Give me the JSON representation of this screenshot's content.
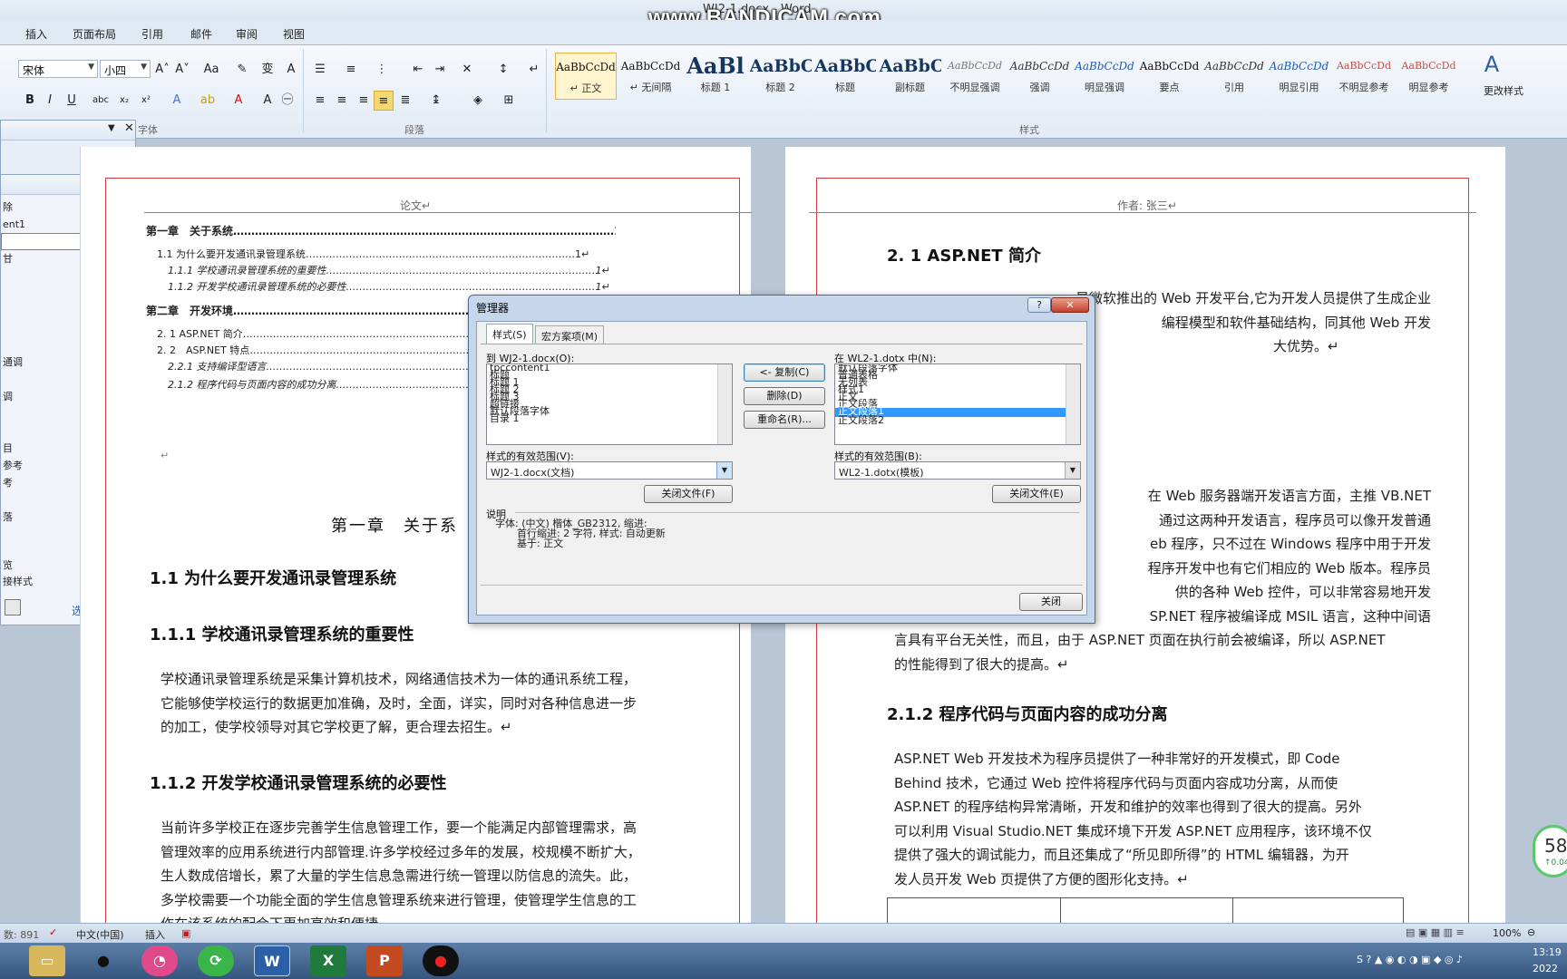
{
  "app": {
    "title": "WJ2-1.docx - Word",
    "watermark": "www.BANDICAM.com"
  },
  "ribbon": {
    "tabs": [
      "插入",
      "页面布局",
      "引用",
      "邮件",
      "审阅",
      "视图"
    ],
    "font_name": "宋体",
    "font_size": "小四",
    "group_labels": {
      "font": "字体",
      "paragraph": "段落",
      "styles": "样式"
    },
    "change_styles": "更改样式",
    "styles": [
      {
        "sample": "AaBbCcDd",
        "name": "↵ 正文"
      },
      {
        "sample": "AaBbCcDd",
        "name": "↵ 无间隔"
      },
      {
        "sample": "AaBl",
        "name": "标题 1"
      },
      {
        "sample": "AaBbC",
        "name": "标题 2"
      },
      {
        "sample": "AaBbC",
        "name": "标题"
      },
      {
        "sample": "AaBbC",
        "name": "副标题"
      },
      {
        "sample": "AaBbCcDd",
        "name": "不明显强调"
      },
      {
        "sample": "AaBbCcDd",
        "name": "强调"
      },
      {
        "sample": "AaBbCcDd",
        "name": "明显强调"
      },
      {
        "sample": "AaBbCcDd",
        "name": "要点"
      },
      {
        "sample": "AaBbCcDd",
        "name": "引用"
      },
      {
        "sample": "AaBbCcDd",
        "name": "明显引用"
      },
      {
        "sample": "AaBbCcDd",
        "name": "不明显参考"
      },
      {
        "sample": "AaBbCcDd",
        "name": "明显参考"
      }
    ]
  },
  "styles_pane": {
    "items": [
      {
        "label": "除",
        "mark": "a"
      },
      {
        "label": "ent1",
        "mark": "a"
      },
      {
        "label": "",
        "mark": "↵"
      },
      {
        "label": "甘",
        "mark": "↵"
      },
      {
        "label": "",
        "mark": "↵"
      },
      {
        "label": "",
        "mark": "↵a"
      },
      {
        "label": "",
        "mark": "↵a"
      },
      {
        "label": "",
        "mark": "↵a"
      },
      {
        "label": "",
        "mark": "↵a"
      },
      {
        "label": "通调",
        "mark": "a"
      },
      {
        "label": "",
        "mark": "a"
      },
      {
        "label": "调",
        "mark": "a"
      },
      {
        "label": "",
        "mark": "a"
      },
      {
        "label": "",
        "mark": "↵a"
      },
      {
        "label": "目",
        "mark": "↵a"
      },
      {
        "label": "参考",
        "mark": "a"
      },
      {
        "label": "考",
        "mark": "a"
      },
      {
        "label": "",
        "mark": "a"
      },
      {
        "label": "落",
        "mark": "↵"
      },
      {
        "label": "",
        "mark": "↵"
      }
    ],
    "preview": "览",
    "linked": "接样式",
    "options": "选项..."
  },
  "left_page": {
    "header": "论文↵",
    "toc": [
      {
        "text": "第一章　关于系统……………………………………………………………………………………………1↵",
        "level": "b"
      },
      {
        "text": "1.1 为什么要开发通讯录管理系统………………………………………………………………………1↵",
        "level": "n"
      },
      {
        "text": "1.1.1 学校通讯录管理系统的重要性………………………………………………………………………1↵",
        "level": "i"
      },
      {
        "text": "1.1.2 开发学校通讯录管理系统的必要性…………………………………………………………………1↵",
        "level": "i"
      },
      {
        "text": "第二章　开发环境……………………………………………………………………………………………",
        "level": "b"
      },
      {
        "text": "2. 1 ASP.NET 简介……………………………………………………………………………………………",
        "level": "n"
      },
      {
        "text": "2. 2　ASP.NET 特点……………………………………………………………………………………………",
        "level": "n"
      },
      {
        "text": "2.2.1 支持编译型语言……………………………………………………………………………………………",
        "level": "i"
      },
      {
        "text": "2.1.2 程序代码与页面内容的成功分离……………………………………………………………………",
        "level": "i"
      }
    ],
    "chapter": "第一章　关于系",
    "h2_1": "1.1 为什么要开发通讯录管理系统",
    "h2_2": "1.1.1 学校通讯录管理系统的重要性",
    "para1": [
      "学校通讯录管理系统是采集计算机技术，网络通信技术为一体的通讯系统工程，",
      "它能够使学校运行的数据更加准确，及时，全面，详实，同时对各种信息进一步",
      "的加工，使学校领导对其它学校更了解，更合理去招生。↵"
    ],
    "h2_3": "1.1.2 开发学校通讯录管理系统的必要性",
    "para2": [
      "当前许多学校正在逐步完善学生信息管理工作，要一个能满足内部管理需求，高",
      "管理效率的应用系统进行内部管理.许多学校经过多年的发展，校规模不断扩大，",
      "生人数成倍增长，累了大量的学生信息急需进行统一管理以防信息的流失。此，",
      "多学校需要一个功能全面的学生信息管理系统来进行管理，使管理学生信息的工",
      "作在该系统的配合下更加高效和便捷。"
    ]
  },
  "right_page": {
    "header": "作者: 张三↵",
    "h2_1": "2. 1 ASP.NET 简介",
    "para1": [
      "是微软推出的 Web 开发平台,它为开发人员提供了生成企业",
      "编程模型和软件基础结构，同其他 Web 开发",
      "大优势。↵"
    ],
    "para2": [
      "在 Web 服务器端开发语言方面，主推 VB.NET",
      "通过这两种开发语言，程序员可以像开发普通",
      "eb 程序，只不过在 Windows 程序中用于开发",
      "程序开发中也有它们相应的 Web 版本。程序员",
      "供的各种 Web 控件，可以非常容易地开发",
      "SP.NET 程序被编译成 MSIL 语言，这种中间语",
      "言具有平台无关性，而且，由于 ASP.NET 页面在执行前会被编译，所以 ASP.NET",
      "的性能得到了很大的提高。↵"
    ],
    "h2_2": "2.1.2 程序代码与页面内容的成功分离",
    "para3": [
      "ASP.NET Web 开发技术为程序员提供了一种非常好的开发模式，即 Code",
      "Behind 技术，它通过 Web 控件将程序代码与页面内容成功分离，从而使",
      "ASP.NET 的程序结构异常清晰，开发和维护的效率也得到了很大的提高。另外",
      "可以利用 Visual Studio.NET 集成环境下开发 ASP.NET 应用程序，该环境不仅",
      "提供了强大的调试能力，而且还集成了“所见即所得”的 HTML 编辑器，为开",
      "发人员开发 Web 页提供了方便的图形化支持。↵"
    ]
  },
  "dialog": {
    "title": "管理器",
    "tabs": [
      "样式(S)",
      "宏方案项(M)"
    ],
    "left_label": "到 WJ2-1.docx(O):",
    "left_list": [
      "tpccontent1",
      "标题",
      "标题 1",
      "标题 2",
      "标题 3",
      "超链接",
      "默认段落字体",
      "目录 1"
    ],
    "right_label": "在 WL2-1.dotx 中(N):",
    "right_list": [
      "默认段落字体",
      "普通表格",
      "无列表",
      "样式1",
      "正文",
      "正文段落",
      "正文段落1",
      "正文段落2"
    ],
    "right_selected_index": 6,
    "copy_btn": "<- 复制(C)",
    "delete_btn": "删除(D)",
    "rename_btn": "重命名(R)...",
    "scope_label_left": "样式的有效范围(V):",
    "scope_value_left": "WJ2-1.docx(文档)",
    "scope_label_right": "样式的有效范围(B):",
    "scope_value_right": "WL2-1.dotx(模板)",
    "close_file_left": "关闭文件(F)",
    "close_file_right": "关闭文件(E)",
    "desc_label": "说明",
    "desc_lines": [
      "字体: (中文) 楷体_GB2312, 缩进:",
      "首行缩进:  2 字符, 样式: 自动更新",
      "基于: 正文"
    ],
    "close_btn": "关闭",
    "help": "?",
    "x": "✕"
  },
  "statusbar": {
    "words": "数: 891",
    "lang": "中文(中国)",
    "mode": "插入",
    "zoom": "100%"
  },
  "taskbar": {
    "time": "13:19",
    "date": "2022",
    "badge": "58",
    "badge_sub": "↑0.04"
  }
}
